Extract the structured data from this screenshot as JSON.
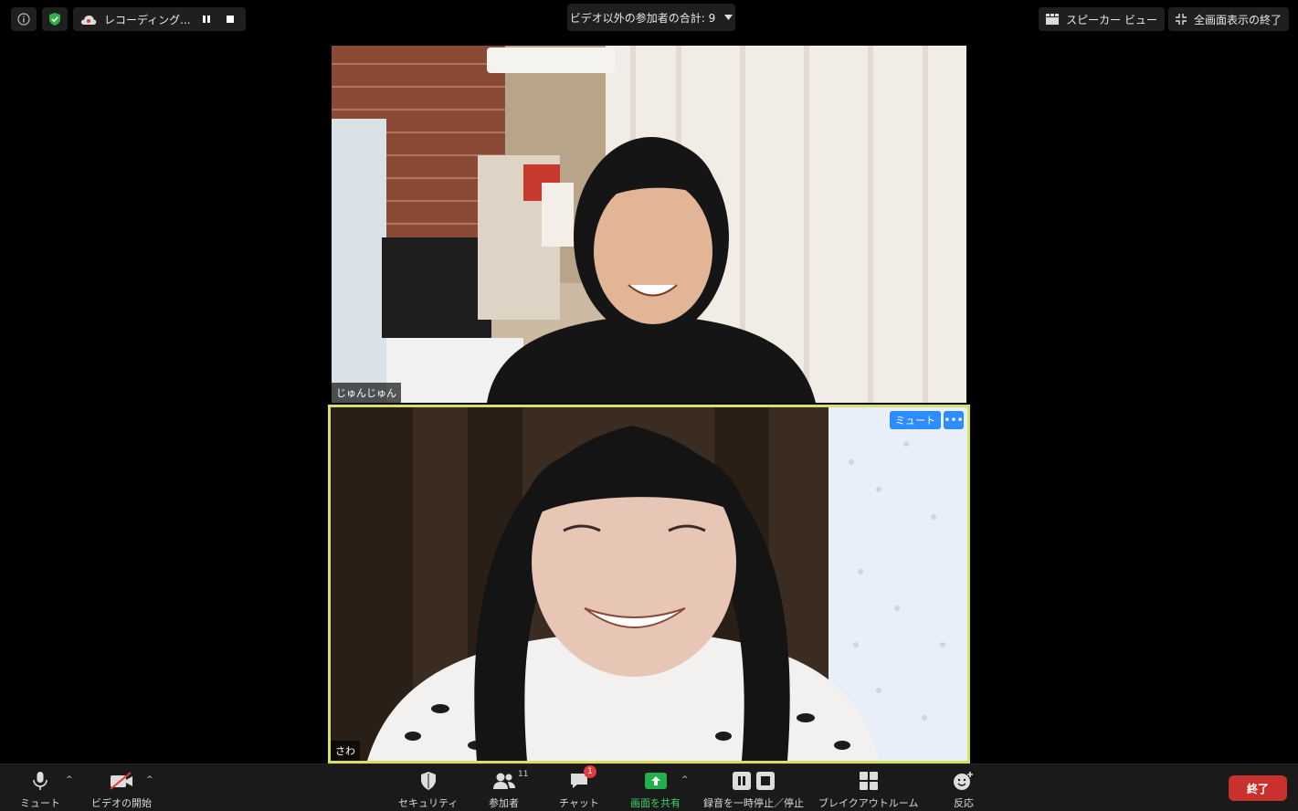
{
  "top_bar": {
    "recording_label": "レコーディング...",
    "participant_count_label": "ビデオ以外の参加者の合計: 9",
    "speaker_view_label": "スピーカー ビュー",
    "exit_fullscreen_label": "全画面表示の終了"
  },
  "videos": [
    {
      "name": "じゅんじゅん",
      "active": false
    },
    {
      "name": "さわ",
      "active": true,
      "mute_label": "ミュート",
      "more_label": "•••"
    }
  ],
  "toolbar": {
    "mute_label": "ミュート",
    "start_video_label": "ビデオの開始",
    "security_label": "セキュリティ",
    "participants_label": "参加者",
    "participants_count": "11",
    "chat_label": "チャット",
    "chat_badge": "1",
    "share_label": "画面を共有",
    "recording_label": "録音を一時停止／停止",
    "breakout_label": "ブレイクアウトルーム",
    "reactions_label": "反応",
    "end_label": "終了"
  },
  "colors": {
    "active_speaker_border": "#d7e064",
    "share_green": "#22b14c",
    "end_red": "#c8312e",
    "accent_blue": "#2d8cff"
  }
}
